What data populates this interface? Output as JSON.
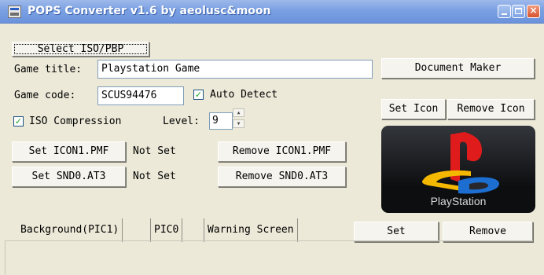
{
  "window": {
    "title": "POPS Converter v1.6 by aeolusc&moon"
  },
  "buttons": {
    "select_iso_pbp": "Select ISO/PBP",
    "document_maker": "Document Maker",
    "set_icon": "Set Icon",
    "remove_icon": "Remove Icon",
    "set_icon1_pmf": "Set ICON1.PMF",
    "remove_icon1_pmf": "Remove ICON1.PMF",
    "set_snd0_at3": "Set SND0.AT3",
    "remove_snd0_at3": "Remove SND0.AT3",
    "set": "Set",
    "remove": "Remove"
  },
  "fields": {
    "game_title_label": "Game title:",
    "game_title_value": "Playstation Game",
    "game_code_label": "Game code:",
    "game_code_value": "SCUS94476",
    "auto_detect_label": "Auto Detect",
    "auto_detect_checked": true,
    "iso_compression_label": "ISO Compression",
    "iso_compression_checked": true,
    "level_label": "Level:",
    "level_value": "9"
  },
  "status": {
    "icon1_pmf": "Not Set",
    "snd0_at3": "Not Set"
  },
  "logo": {
    "caption": "PlayStation"
  },
  "tabs": [
    "Background(PIC1)",
    "PIC0",
    "Warning Screen"
  ],
  "colors": {
    "titlebar": "#7aa0e2",
    "window_bg": "#ece9d8",
    "ps_red": "#e01b1b",
    "ps_yellow": "#f5b800",
    "ps_blue": "#1c6fd1"
  }
}
